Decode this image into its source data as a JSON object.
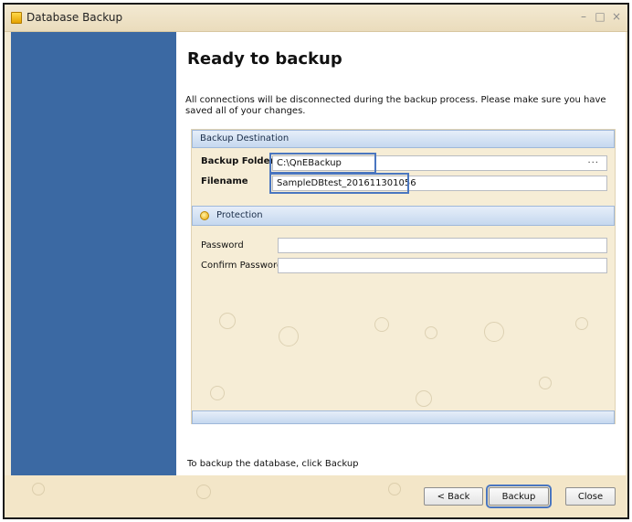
{
  "window": {
    "title": "Database Backup",
    "controls": [
      "–",
      "□",
      "×"
    ]
  },
  "page": {
    "heading": "Ready to backup",
    "info": "All connections will be disconnected during the backup process. Please make sure you have saved all of your changes.",
    "footer": "To backup the database, click Backup"
  },
  "destination": {
    "header": "Backup Destination",
    "folder_label": "Backup Folder",
    "folder_value": "C:\\QnEBackup",
    "browse": "···",
    "filename_label": "Filename",
    "filename_value": "SampleDBtest_201611301056"
  },
  "protection": {
    "header": "Protection",
    "password_label": "Password",
    "password_value": "",
    "confirm_label": "Confirm Password",
    "confirm_value": ""
  },
  "buttons": {
    "back": "< Back",
    "backup": "Backup",
    "close": "Close"
  },
  "colors": {
    "sidebar": "#3b69a3",
    "highlight": "#4a76c0",
    "background": "#f4ead3"
  }
}
